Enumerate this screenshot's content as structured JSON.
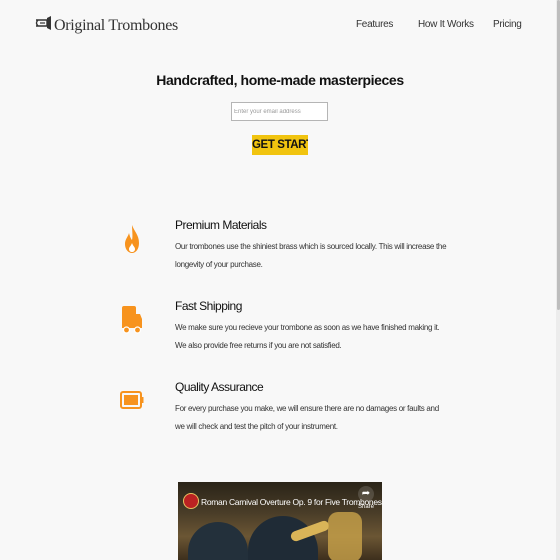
{
  "header": {
    "logo_text": "Original Trombones",
    "nav": [
      {
        "label": "Features"
      },
      {
        "label": "How It Works"
      },
      {
        "label": "Pricing"
      }
    ]
  },
  "hero": {
    "title": "Handcrafted, home-made masterpieces",
    "email_placeholder": "Enter your email address",
    "cta_label": "GET STARTE"
  },
  "features": [
    {
      "icon": "flame-icon",
      "title": "Premium Materials",
      "text": "Our trombones use the shiniest brass which is sourced locally. This will increase the longevity of your purchase."
    },
    {
      "icon": "truck-icon",
      "title": "Fast Shipping",
      "text": "We make sure you recieve your trombone as soon as we have finished making it. We also provide free returns if you are not satisfied."
    },
    {
      "icon": "battery-icon",
      "title": "Quality Assurance",
      "text": "For every purchase you make, we will ensure there are no damages or faults and we will check and test the pitch of your instrument."
    }
  ],
  "video": {
    "title": "Roman Carnival Overture Op. 9 for Five Trombones",
    "share_label": "Share"
  },
  "colors": {
    "accent": "#f1c40f",
    "icon_orange": "#f7931e"
  }
}
